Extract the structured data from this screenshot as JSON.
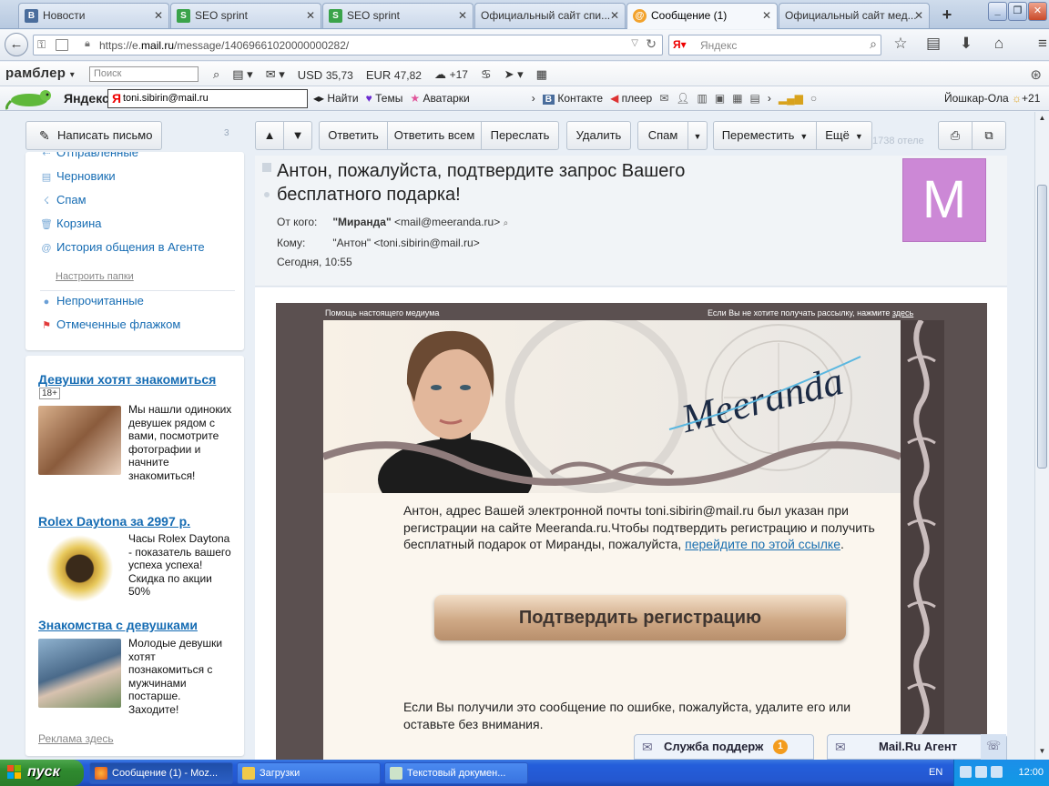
{
  "browser": {
    "tabs": [
      {
        "label": "Новости",
        "icon": "vk-icon",
        "active": false
      },
      {
        "label": "SEO sprint",
        "icon": "seosprint-icon",
        "active": false
      },
      {
        "label": "SEO sprint",
        "icon": "seosprint-icon",
        "active": false
      },
      {
        "label": "Официальный сайт спи...",
        "icon": "",
        "active": false
      },
      {
        "label": "Сообщение (1)",
        "icon": "mailru-icon",
        "active": true
      },
      {
        "label": "Официальный сайт мед...",
        "icon": "",
        "active": false
      }
    ],
    "url_prefix": "https://e.",
    "url_domain": "mail.ru",
    "url_path": "/message/14069661020000000282/",
    "search_engine": "Яндекс",
    "search_placeholder": "Яндекс"
  },
  "rambler_bar": {
    "logo": "рамблер",
    "search_placeholder": "Поиск",
    "usd_label": "USD",
    "usd_value": "35,73",
    "eur_label": "EUR",
    "eur_value": "47,82",
    "weather": "+17"
  },
  "yandex_bar": {
    "logo": "Яндекс",
    "login_value": "toni.sibirin@mail.ru",
    "find_label": "Найти",
    "themes_label": "Темы",
    "avatars_label": "Аватарки",
    "vk_label": "Контакте",
    "player_label": "плеер",
    "city": "Йошкар-Ола",
    "temperature": "+21"
  },
  "mail": {
    "compose_label": "Написать письмо",
    "compose_count": "3",
    "folders": [
      {
        "label": "Отправленные",
        "icon": "sent-icon"
      },
      {
        "label": "Черновики",
        "icon": "drafts-icon"
      },
      {
        "label": "Спам",
        "icon": "spam-icon"
      },
      {
        "label": "Корзина",
        "icon": "trash-icon"
      },
      {
        "label": "История общения в Агенте",
        "icon": "agent-icon"
      }
    ],
    "folder_settings": "Настроить папки",
    "unread_label": "Непрочитанные",
    "flagged_label": "Отмеченные флажком",
    "toolbar": {
      "reply": "Ответить",
      "reply_all": "Ответить всем",
      "forward": "Переслать",
      "delete": "Удалить",
      "spam": "Спам",
      "move": "Переместить",
      "more": "Ещё",
      "background_text": "1738 отеле"
    },
    "message": {
      "subject": "Антон, пожалуйста, подтвердите запрос Вашего бесплатного подарка!",
      "from_label": "От кого:",
      "from_name": "\"Миранда\"",
      "from_email": "<mail@meeranda.ru>",
      "to_label": "Кому:",
      "to_value": "\"Антон\" <toni.sibirin@mail.ru>",
      "date": "Сегодня, 10:55",
      "avatar_letter": "М",
      "avatar_color": "#cc88d6"
    },
    "email_body": {
      "top_left": "Помощь настоящего медиума",
      "top_right_prefix": "Если Вы не хотите получать рассылку, нажмите ",
      "top_right_link": "здесь",
      "logo_text": "Meeranda",
      "para1": "Антон, адрес Вашей электронной почты toni.sibirin@mail.ru был указан при регистрации на сайте Meeranda.ru.Чтобы подтвердить регистрацию и получить бесплатный подарок от Миранды, пожалуйста, ",
      "para1_link": "перейдите по этой ссылке",
      "para1_end": ".",
      "confirm_button": "Подтвердить регистрацию",
      "para2": "Если Вы получили это сообщение по ошибке, пожалуйста, удалите его или оставьте без внимания."
    },
    "ads": [
      {
        "title": "Девушки хотят знакомиться",
        "age": "18+",
        "text": "Мы нашли одиноких девушек рядом с вами, посмотрите фотографии и начните знакомиться!"
      },
      {
        "title": "Rolex Daytona за 2997 р.",
        "text": "Часы Rolex Daytona - показатель вашего успеха успеха! Скидка по акции 50%"
      },
      {
        "title": "Знакомства с девушками",
        "text": "Молодые девушки хотят познакомиться с мужчинами постарше. Заходите!"
      }
    ],
    "ads_footer": "Реклама здесь",
    "support_chat": "Служба поддерж",
    "support_badge": "1",
    "agent_chat": "Mail.Ru Агент"
  },
  "taskbar": {
    "start": "пуск",
    "tasks": [
      {
        "label": "Сообщение (1) - Moz...",
        "active": true
      },
      {
        "label": "Загрузки",
        "active": false
      },
      {
        "label": "Текстовый докумен...",
        "active": false
      }
    ],
    "lang": "EN",
    "clock": "12:00"
  }
}
